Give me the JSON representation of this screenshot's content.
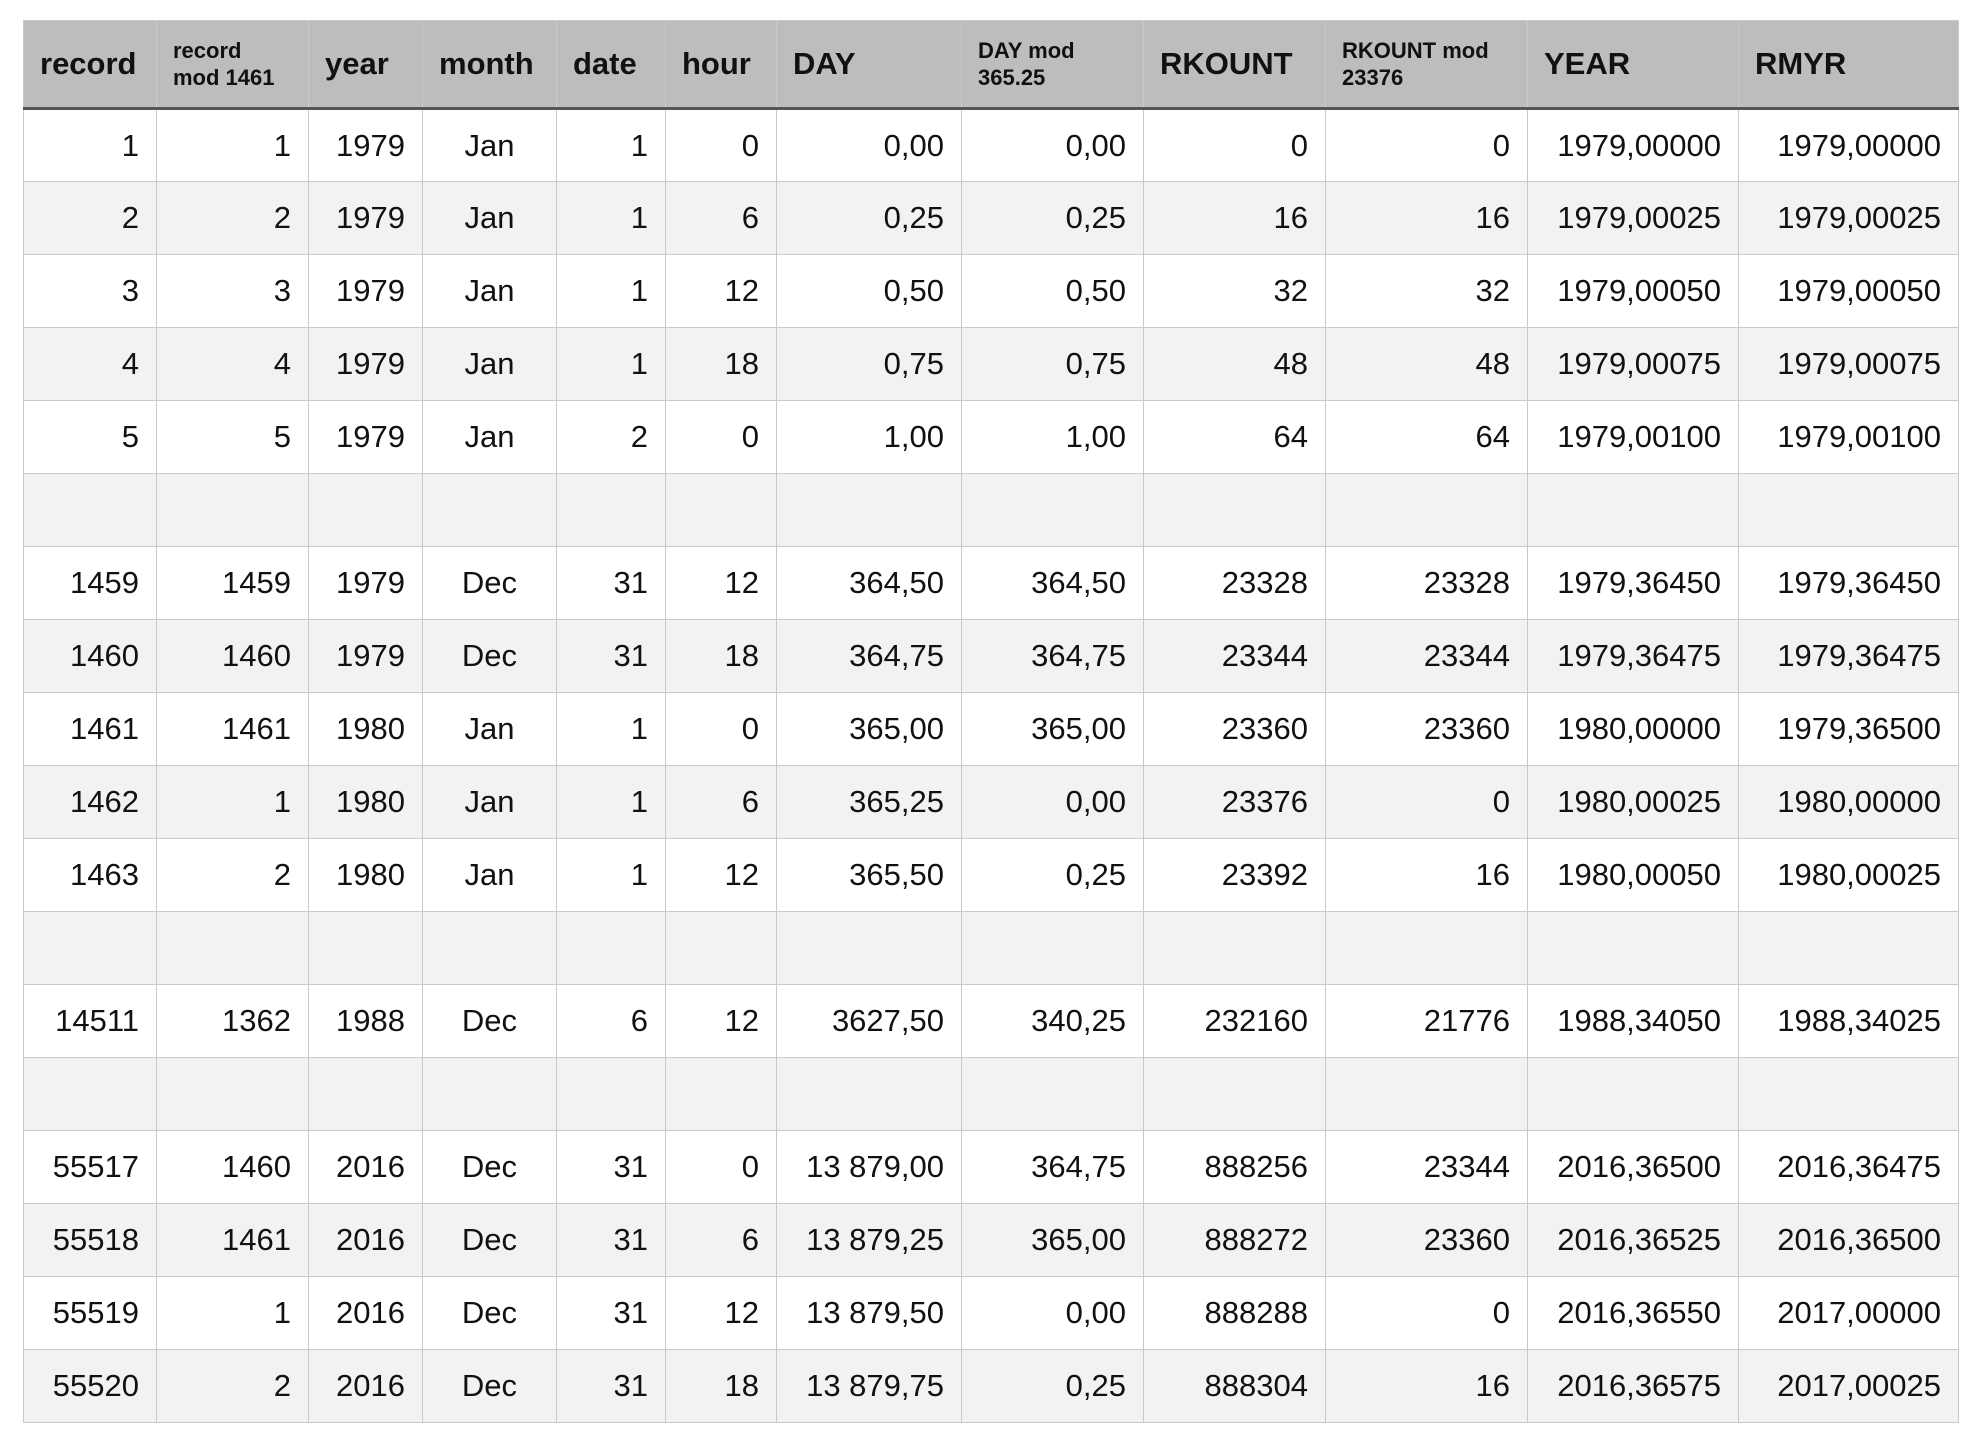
{
  "table": {
    "columns": [
      {
        "key": "record",
        "lines": [
          "record"
        ],
        "small": false
      },
      {
        "key": "record_mod",
        "lines": [
          "record",
          "mod 1461"
        ],
        "small": true
      },
      {
        "key": "year",
        "lines": [
          "year"
        ],
        "small": false
      },
      {
        "key": "month",
        "lines": [
          "month"
        ],
        "small": false
      },
      {
        "key": "date",
        "lines": [
          "date"
        ],
        "small": false
      },
      {
        "key": "hour",
        "lines": [
          "hour"
        ],
        "small": false
      },
      {
        "key": "DAY",
        "lines": [
          "DAY"
        ],
        "small": false
      },
      {
        "key": "DAY_mod",
        "lines": [
          "DAY mod",
          "365.25"
        ],
        "small": true
      },
      {
        "key": "RKOUNT",
        "lines": [
          "RKOUNT"
        ],
        "small": false
      },
      {
        "key": "RKOUNT_mod",
        "lines": [
          "RKOUNT mod",
          "23376"
        ],
        "small": true
      },
      {
        "key": "YEAR",
        "lines": [
          "YEAR"
        ],
        "small": false
      },
      {
        "key": "RMYR",
        "lines": [
          "RMYR"
        ],
        "small": false
      }
    ],
    "rows": [
      [
        "1",
        "1",
        "1979",
        "Jan",
        "1",
        "0",
        "0,00",
        "0,00",
        "0",
        "0",
        "1979,00000",
        "1979,00000"
      ],
      [
        "2",
        "2",
        "1979",
        "Jan",
        "1",
        "6",
        "0,25",
        "0,25",
        "16",
        "16",
        "1979,00025",
        "1979,00025"
      ],
      [
        "3",
        "3",
        "1979",
        "Jan",
        "1",
        "12",
        "0,50",
        "0,50",
        "32",
        "32",
        "1979,00050",
        "1979,00050"
      ],
      [
        "4",
        "4",
        "1979",
        "Jan",
        "1",
        "18",
        "0,75",
        "0,75",
        "48",
        "48",
        "1979,00075",
        "1979,00075"
      ],
      [
        "5",
        "5",
        "1979",
        "Jan",
        "2",
        "0",
        "1,00",
        "1,00",
        "64",
        "64",
        "1979,00100",
        "1979,00100"
      ],
      [
        "",
        "",
        "",
        "",
        "",
        "",
        "",
        "",
        "",
        "",
        "",
        ""
      ],
      [
        "1459",
        "1459",
        "1979",
        "Dec",
        "31",
        "12",
        "364,50",
        "364,50",
        "23328",
        "23328",
        "1979,36450",
        "1979,36450"
      ],
      [
        "1460",
        "1460",
        "1979",
        "Dec",
        "31",
        "18",
        "364,75",
        "364,75",
        "23344",
        "23344",
        "1979,36475",
        "1979,36475"
      ],
      [
        "1461",
        "1461",
        "1980",
        "Jan",
        "1",
        "0",
        "365,00",
        "365,00",
        "23360",
        "23360",
        "1980,00000",
        "1979,36500"
      ],
      [
        "1462",
        "1",
        "1980",
        "Jan",
        "1",
        "6",
        "365,25",
        "0,00",
        "23376",
        "0",
        "1980,00025",
        "1980,00000"
      ],
      [
        "1463",
        "2",
        "1980",
        "Jan",
        "1",
        "12",
        "365,50",
        "0,25",
        "23392",
        "16",
        "1980,00050",
        "1980,00025"
      ],
      [
        "",
        "",
        "",
        "",
        "",
        "",
        "",
        "",
        "",
        "",
        "",
        ""
      ],
      [
        "14511",
        "1362",
        "1988",
        "Dec",
        "6",
        "12",
        "3627,50",
        "340,25",
        "232160",
        "21776",
        "1988,34050",
        "1988,34025"
      ],
      [
        "",
        "",
        "",
        "",
        "",
        "",
        "",
        "",
        "",
        "",
        "",
        ""
      ],
      [
        "55517",
        "1460",
        "2016",
        "Dec",
        "31",
        "0",
        "13 879,00",
        "364,75",
        "888256",
        "23344",
        "2016,36500",
        "2016,36475"
      ],
      [
        "55518",
        "1461",
        "2016",
        "Dec",
        "31",
        "6",
        "13 879,25",
        "365,00",
        "888272",
        "23360",
        "2016,36525",
        "2016,36500"
      ],
      [
        "55519",
        "1",
        "2016",
        "Dec",
        "31",
        "12",
        "13 879,50",
        "0,00",
        "888288",
        "0",
        "2016,36550",
        "2017,00000"
      ],
      [
        "55520",
        "2",
        "2016",
        "Dec",
        "31",
        "18",
        "13 879,75",
        "0,25",
        "888304",
        "16",
        "2016,36575",
        "2017,00025"
      ]
    ]
  }
}
